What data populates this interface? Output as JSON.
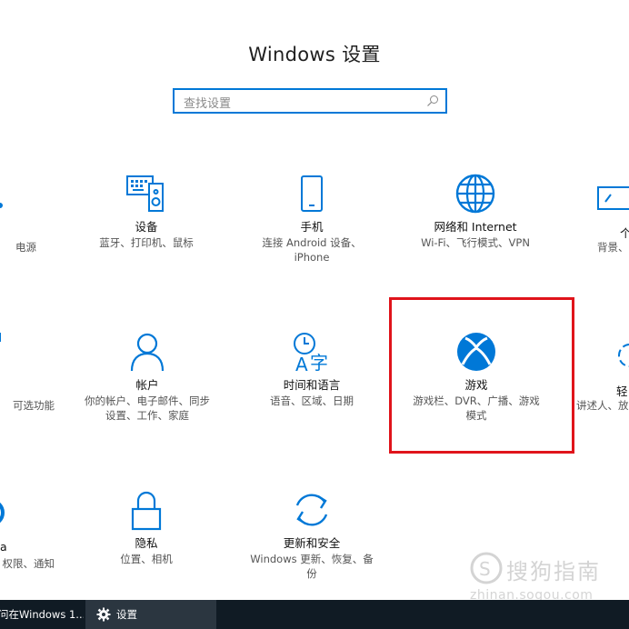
{
  "window": {
    "title": "Windows 设置"
  },
  "search": {
    "placeholder": "查找设置"
  },
  "tiles": [
    {
      "name": "",
      "desc": "电源"
    },
    {
      "name": "设备",
      "desc": "蓝牙、打印机、鼠标"
    },
    {
      "name": "手机",
      "desc1": "连接 Android 设备、",
      "desc2": "iPhone"
    },
    {
      "name": "网络和 Internet",
      "desc": "Wi-Fi、飞行模式、VPN"
    },
    {
      "name": "个",
      "desc": "背景、"
    },
    {
      "name": "",
      "desc": "可选功能"
    },
    {
      "name": "帐户",
      "desc1": "你的帐户、电子邮件、同步",
      "desc2": "设置、工作、家庭"
    },
    {
      "name": "时间和语言",
      "desc": "语音、区域、日期"
    },
    {
      "name": "游戏",
      "desc1": "游戏栏、DVR、广播、游戏",
      "desc2": "模式"
    },
    {
      "name": "轻",
      "desc": "讲述人、放"
    },
    {
      "name": "a",
      "desc": "权限、通知"
    },
    {
      "name": "隐私",
      "desc": "位置、相机"
    },
    {
      "name": "更新和安全",
      "desc1": "Windows 更新、恢复、备",
      "desc2": "份"
    }
  ],
  "taskbar": {
    "item1": "问在Windows 1...",
    "item2": "设置"
  },
  "watermark": {
    "line1": "搜狗指南",
    "line2": "zhinan.sogou.com"
  },
  "colors": {
    "accent": "#0078d7",
    "highlight": "#e0141b",
    "taskbar": "#101b24"
  }
}
